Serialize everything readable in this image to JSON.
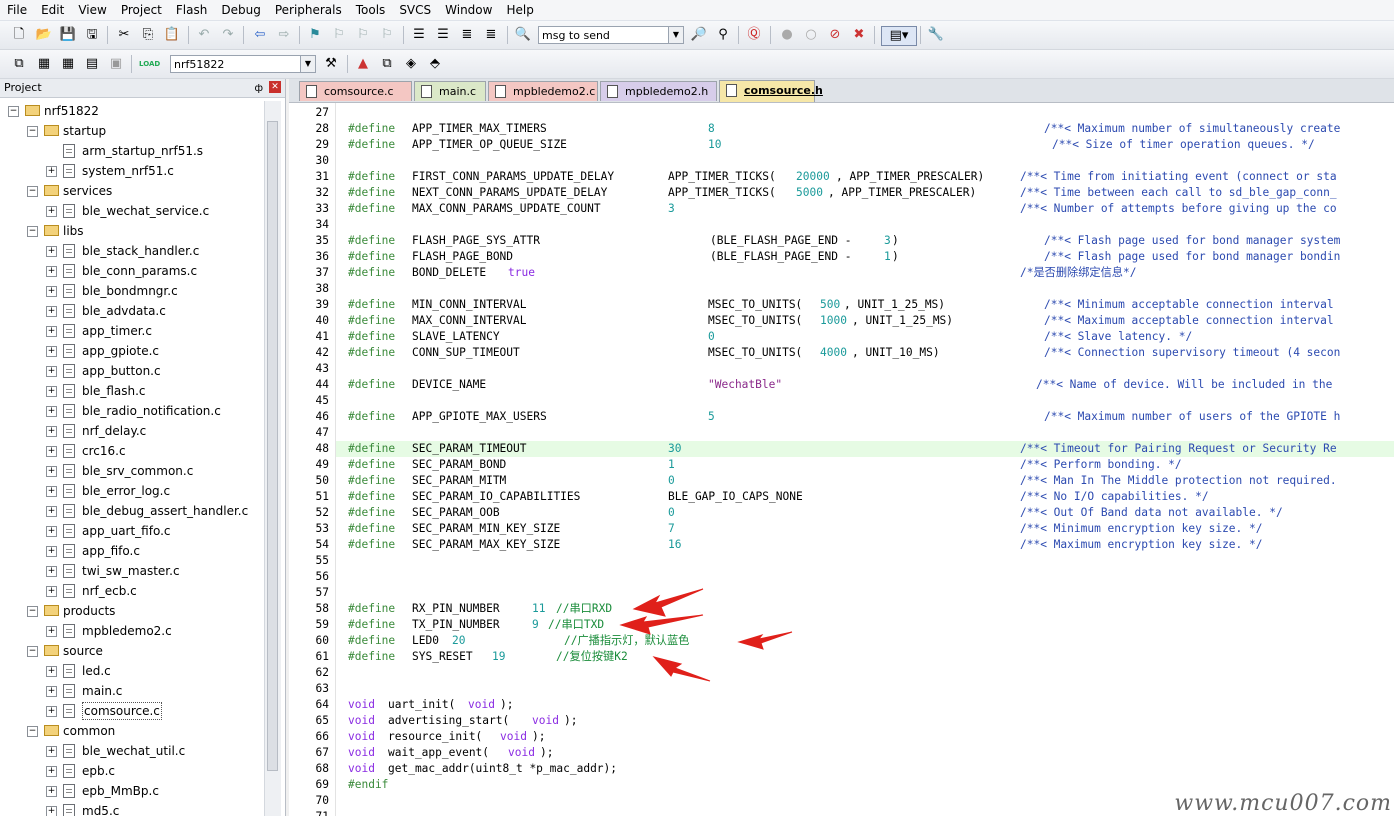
{
  "menu": [
    "File",
    "Edit",
    "View",
    "Project",
    "Flash",
    "Debug",
    "Peripherals",
    "Tools",
    "SVCS",
    "Window",
    "Help"
  ],
  "toolbar": {
    "find_combo": "msg to send",
    "target_combo": "nrf51822"
  },
  "project_panel": {
    "title": "Project",
    "pin": "ф",
    "close": "✕"
  },
  "tree": [
    {
      "label": "nrf51822",
      "level": 0,
      "type": "root"
    },
    {
      "label": "startup",
      "level": 1,
      "type": "folder"
    },
    {
      "label": "arm_startup_nrf51.s",
      "level": 2,
      "type": "file",
      "expand": false
    },
    {
      "label": "system_nrf51.c",
      "level": 2,
      "type": "file",
      "expand": true
    },
    {
      "label": "services",
      "level": 1,
      "type": "folder"
    },
    {
      "label": "ble_wechat_service.c",
      "level": 2,
      "type": "file",
      "expand": true
    },
    {
      "label": "libs",
      "level": 1,
      "type": "folder"
    },
    {
      "label": "ble_stack_handler.c",
      "level": 2,
      "type": "file",
      "expand": true
    },
    {
      "label": "ble_conn_params.c",
      "level": 2,
      "type": "file",
      "expand": true
    },
    {
      "label": "ble_bondmngr.c",
      "level": 2,
      "type": "file",
      "expand": true
    },
    {
      "label": "ble_advdata.c",
      "level": 2,
      "type": "file",
      "expand": true
    },
    {
      "label": "app_timer.c",
      "level": 2,
      "type": "file",
      "expand": true
    },
    {
      "label": "app_gpiote.c",
      "level": 2,
      "type": "file",
      "expand": true
    },
    {
      "label": "app_button.c",
      "level": 2,
      "type": "file",
      "expand": true
    },
    {
      "label": "ble_flash.c",
      "level": 2,
      "type": "file",
      "expand": true
    },
    {
      "label": "ble_radio_notification.c",
      "level": 2,
      "type": "file",
      "expand": true
    },
    {
      "label": "nrf_delay.c",
      "level": 2,
      "type": "file",
      "expand": true
    },
    {
      "label": "crc16.c",
      "level": 2,
      "type": "file",
      "expand": true
    },
    {
      "label": "ble_srv_common.c",
      "level": 2,
      "type": "file",
      "expand": true
    },
    {
      "label": "ble_error_log.c",
      "level": 2,
      "type": "file",
      "expand": true
    },
    {
      "label": "ble_debug_assert_handler.c",
      "level": 2,
      "type": "file",
      "expand": true
    },
    {
      "label": "app_uart_fifo.c",
      "level": 2,
      "type": "file",
      "expand": true
    },
    {
      "label": "app_fifo.c",
      "level": 2,
      "type": "file",
      "expand": true
    },
    {
      "label": "twi_sw_master.c",
      "level": 2,
      "type": "file",
      "expand": true
    },
    {
      "label": "nrf_ecb.c",
      "level": 2,
      "type": "file",
      "expand": true
    },
    {
      "label": "products",
      "level": 1,
      "type": "folder"
    },
    {
      "label": "mpbledemo2.c",
      "level": 2,
      "type": "file",
      "expand": true
    },
    {
      "label": "source",
      "level": 1,
      "type": "folder"
    },
    {
      "label": "led.c",
      "level": 2,
      "type": "file",
      "expand": true
    },
    {
      "label": "main.c",
      "level": 2,
      "type": "file",
      "expand": true
    },
    {
      "label": "comsource.c",
      "level": 2,
      "type": "file",
      "expand": true,
      "selected": true
    },
    {
      "label": "common",
      "level": 1,
      "type": "folder"
    },
    {
      "label": "ble_wechat_util.c",
      "level": 2,
      "type": "file",
      "expand": true
    },
    {
      "label": "epb.c",
      "level": 2,
      "type": "file",
      "expand": true
    },
    {
      "label": "epb_MmBp.c",
      "level": 2,
      "type": "file",
      "expand": true
    },
    {
      "label": "md5.c",
      "level": 2,
      "type": "file",
      "expand": true
    }
  ],
  "tabs": [
    {
      "label": "comsource.c",
      "color": "#f4c7c3",
      "active": false
    },
    {
      "label": "main.c",
      "color": "#dbe8c8",
      "active": false
    },
    {
      "label": "mpbledemo2.c",
      "color": "#f4c7c3",
      "active": false
    },
    {
      "label": "mpbledemo2.h",
      "color": "#d7cdea",
      "active": false
    },
    {
      "label": "comsource.h",
      "color": "#f6e7a8",
      "active": true
    }
  ],
  "highlight_line": "48",
  "code_lines": [
    {
      "n": "27",
      "segs": []
    },
    {
      "n": "28",
      "segs": [
        [
          "pp",
          "#define"
        ],
        [
          "",
          "APP_TIMER_MAX_TIMERS",
          64
        ],
        [
          "num",
          "8",
          360
        ],
        [
          "cm",
          "/**< Maximum number of simultaneously create",
          696
        ]
      ]
    },
    {
      "n": "29",
      "segs": [
        [
          "pp",
          "#define"
        ],
        [
          "",
          "APP_TIMER_OP_QUEUE_SIZE",
          64
        ],
        [
          "num",
          "10",
          360
        ],
        [
          "cm",
          "/**< Size of timer operation queues. */",
          704
        ]
      ]
    },
    {
      "n": "30",
      "segs": []
    },
    {
      "n": "31",
      "segs": [
        [
          "pp",
          "#define"
        ],
        [
          "",
          "FIRST_CONN_PARAMS_UPDATE_DELAY",
          64
        ],
        [
          "",
          "APP_TIMER_TICKS(",
          320
        ],
        [
          "num",
          "20000",
          448
        ],
        [
          "",
          ", APP_TIMER_PRESCALER)",
          488
        ],
        [
          "cm",
          "/**< Time from initiating event (connect or sta",
          672
        ]
      ]
    },
    {
      "n": "32",
      "segs": [
        [
          "pp",
          "#define"
        ],
        [
          "",
          "NEXT_CONN_PARAMS_UPDATE_DELAY",
          64
        ],
        [
          "",
          "APP_TIMER_TICKS(",
          320
        ],
        [
          "num",
          "5000",
          448
        ],
        [
          "",
          ", APP_TIMER_PRESCALER)",
          480
        ],
        [
          "cm",
          "/**< Time between each call to sd_ble_gap_conn_",
          672
        ]
      ]
    },
    {
      "n": "33",
      "segs": [
        [
          "pp",
          "#define"
        ],
        [
          "",
          "MAX_CONN_PARAMS_UPDATE_COUNT",
          64
        ],
        [
          "num",
          "3",
          320
        ],
        [
          "cm",
          "/**< Number of attempts before giving up the co",
          672
        ]
      ]
    },
    {
      "n": "34",
      "segs": []
    },
    {
      "n": "35",
      "segs": [
        [
          "pp",
          "#define"
        ],
        [
          "",
          "FLASH_PAGE_SYS_ATTR",
          64
        ],
        [
          "",
          "(BLE_FLASH_PAGE_END - ",
          362
        ],
        [
          "num",
          "3",
          536
        ],
        [
          "",
          ")",
          544
        ],
        [
          "cm",
          "/**< Flash page used for bond manager system",
          696
        ]
      ]
    },
    {
      "n": "36",
      "segs": [
        [
          "pp",
          "#define"
        ],
        [
          "",
          "FLASH_PAGE_BOND",
          64
        ],
        [
          "",
          "(BLE_FLASH_PAGE_END - ",
          362
        ],
        [
          "num",
          "1",
          536
        ],
        [
          "",
          ")",
          544
        ],
        [
          "cm",
          "/**< Flash page used for bond manager bondin",
          696
        ]
      ]
    },
    {
      "n": "37",
      "segs": [
        [
          "pp",
          "#define"
        ],
        [
          "",
          "BOND_DELETE",
          64
        ],
        [
          "kw",
          "true",
          160
        ],
        [
          "cm",
          "/*是否删除绑定信息*/",
          672
        ]
      ]
    },
    {
      "n": "38",
      "segs": []
    },
    {
      "n": "39",
      "segs": [
        [
          "pp",
          "#define"
        ],
        [
          "",
          "MIN_CONN_INTERVAL",
          64
        ],
        [
          "",
          "MSEC_TO_UNITS(",
          360
        ],
        [
          "num",
          "500",
          472
        ],
        [
          "",
          ", UNIT_1_25_MS)",
          496
        ],
        [
          "cm",
          "/**< Minimum acceptable connection interval",
          696
        ]
      ]
    },
    {
      "n": "40",
      "segs": [
        [
          "pp",
          "#define"
        ],
        [
          "",
          "MAX_CONN_INTERVAL",
          64
        ],
        [
          "",
          "MSEC_TO_UNITS(",
          360
        ],
        [
          "num",
          "1000",
          472
        ],
        [
          "",
          ", UNIT_1_25_MS)",
          504
        ],
        [
          "cm",
          "/**< Maximum acceptable connection interval",
          696
        ]
      ]
    },
    {
      "n": "41",
      "segs": [
        [
          "pp",
          "#define"
        ],
        [
          "",
          "SLAVE_LATENCY",
          64
        ],
        [
          "num",
          "0",
          360
        ],
        [
          "cm",
          "/**< Slave latency. */",
          696
        ]
      ]
    },
    {
      "n": "42",
      "segs": [
        [
          "pp",
          "#define"
        ],
        [
          "",
          "CONN_SUP_TIMEOUT",
          64
        ],
        [
          "",
          "MSEC_TO_UNITS(",
          360
        ],
        [
          "num",
          "4000",
          472
        ],
        [
          "",
          ", UNIT_10_MS)",
          504
        ],
        [
          "cm",
          "/**< Connection supervisory timeout (4 secon",
          696
        ]
      ]
    },
    {
      "n": "43",
      "segs": []
    },
    {
      "n": "44",
      "segs": [
        [
          "pp",
          "#define"
        ],
        [
          "",
          "DEVICE_NAME",
          64
        ],
        [
          "str",
          "\"WechatBle\"",
          360
        ],
        [
          "cm",
          "/**< Name of device. Will be included in the",
          688
        ]
      ]
    },
    {
      "n": "45",
      "segs": []
    },
    {
      "n": "46",
      "segs": [
        [
          "pp",
          "#define"
        ],
        [
          "",
          "APP_GPIOTE_MAX_USERS",
          64
        ],
        [
          "num",
          "5",
          360
        ],
        [
          "cm",
          "/**< Maximum number of users of the GPIOTE h",
          696
        ]
      ]
    },
    {
      "n": "47",
      "segs": []
    },
    {
      "n": "48",
      "segs": [
        [
          "pp",
          "#define"
        ],
        [
          "",
          "SEC_PARAM_TIMEOUT",
          64
        ],
        [
          "num",
          "30",
          320
        ],
        [
          "cm",
          "/**< Timeout for Pairing Request or Security Re",
          672
        ]
      ]
    },
    {
      "n": "49",
      "segs": [
        [
          "pp",
          "#define"
        ],
        [
          "",
          "SEC_PARAM_BOND",
          64
        ],
        [
          "num",
          "1",
          320
        ],
        [
          "cm",
          "/**< Perform bonding. */",
          672
        ]
      ]
    },
    {
      "n": "50",
      "segs": [
        [
          "pp",
          "#define"
        ],
        [
          "",
          "SEC_PARAM_MITM",
          64
        ],
        [
          "num",
          "0",
          320
        ],
        [
          "cm",
          "/**< Man In The Middle protection not required.",
          672
        ]
      ]
    },
    {
      "n": "51",
      "segs": [
        [
          "pp",
          "#define"
        ],
        [
          "",
          "SEC_PARAM_IO_CAPABILITIES",
          64
        ],
        [
          "",
          "BLE_GAP_IO_CAPS_NONE",
          320
        ],
        [
          "cm",
          "/**< No I/O capabilities. */",
          672
        ]
      ]
    },
    {
      "n": "52",
      "segs": [
        [
          "pp",
          "#define"
        ],
        [
          "",
          "SEC_PARAM_OOB",
          64
        ],
        [
          "num",
          "0",
          320
        ],
        [
          "cm",
          "/**< Out Of Band data not available. */",
          672
        ]
      ]
    },
    {
      "n": "53",
      "segs": [
        [
          "pp",
          "#define"
        ],
        [
          "",
          "SEC_PARAM_MIN_KEY_SIZE",
          64
        ],
        [
          "num",
          "7",
          320
        ],
        [
          "cm",
          "/**< Minimum encryption key size. */",
          672
        ]
      ]
    },
    {
      "n": "54",
      "segs": [
        [
          "pp",
          "#define"
        ],
        [
          "",
          "SEC_PARAM_MAX_KEY_SIZE",
          64
        ],
        [
          "num",
          "16",
          320
        ],
        [
          "cm",
          "/**< Maximum encryption key size. */",
          672
        ]
      ]
    },
    {
      "n": "55",
      "segs": []
    },
    {
      "n": "56",
      "segs": []
    },
    {
      "n": "57",
      "segs": []
    },
    {
      "n": "58",
      "segs": [
        [
          "pp",
          "#define"
        ],
        [
          "",
          "RX_PIN_NUMBER",
          64
        ],
        [
          "num",
          "11",
          184
        ],
        [
          "gr",
          "//串口RXD",
          208
        ]
      ]
    },
    {
      "n": "59",
      "segs": [
        [
          "pp",
          "#define"
        ],
        [
          "",
          "TX_PIN_NUMBER",
          64
        ],
        [
          "num",
          "9",
          184
        ],
        [
          "gr",
          "//串口TXD",
          200
        ]
      ]
    },
    {
      "n": "60",
      "segs": [
        [
          "pp",
          "#define"
        ],
        [
          "",
          "LED0",
          64
        ],
        [
          "num",
          "20",
          104
        ],
        [
          "gr",
          "//广播指示灯，默认蓝色",
          216
        ]
      ]
    },
    {
      "n": "61",
      "segs": [
        [
          "pp",
          "#define"
        ],
        [
          "",
          "SYS_RESET",
          64
        ],
        [
          "num",
          "19",
          144
        ],
        [
          "gr",
          "//复位按键K2",
          208
        ]
      ]
    },
    {
      "n": "62",
      "segs": []
    },
    {
      "n": "63",
      "segs": []
    },
    {
      "n": "64",
      "segs": [
        [
          "kw",
          "void"
        ],
        [
          "",
          "uart_init(",
          40
        ],
        [
          "kw",
          "void",
          120
        ],
        [
          "",
          ");",
          152
        ]
      ]
    },
    {
      "n": "65",
      "segs": [
        [
          "kw",
          "void"
        ],
        [
          "",
          "advertising_start(",
          40
        ],
        [
          "kw",
          "void",
          184
        ],
        [
          "",
          ");",
          216
        ]
      ]
    },
    {
      "n": "66",
      "segs": [
        [
          "kw",
          "void"
        ],
        [
          "",
          "resource_init(",
          40
        ],
        [
          "kw",
          "void",
          152
        ],
        [
          "",
          ");",
          184
        ]
      ]
    },
    {
      "n": "67",
      "segs": [
        [
          "kw",
          "void"
        ],
        [
          "",
          "wait_app_event(",
          40
        ],
        [
          "kw",
          "void",
          160
        ],
        [
          "",
          ");",
          192
        ]
      ]
    },
    {
      "n": "68",
      "segs": [
        [
          "kw",
          "void"
        ],
        [
          "",
          "get_mac_addr(uint8_t *p_mac_addr);",
          40
        ]
      ]
    },
    {
      "n": "69",
      "segs": [
        [
          "pp",
          "#endif"
        ]
      ]
    },
    {
      "n": "70",
      "segs": []
    },
    {
      "n": "71",
      "segs": []
    }
  ],
  "watermark": "www.mcu007.com"
}
